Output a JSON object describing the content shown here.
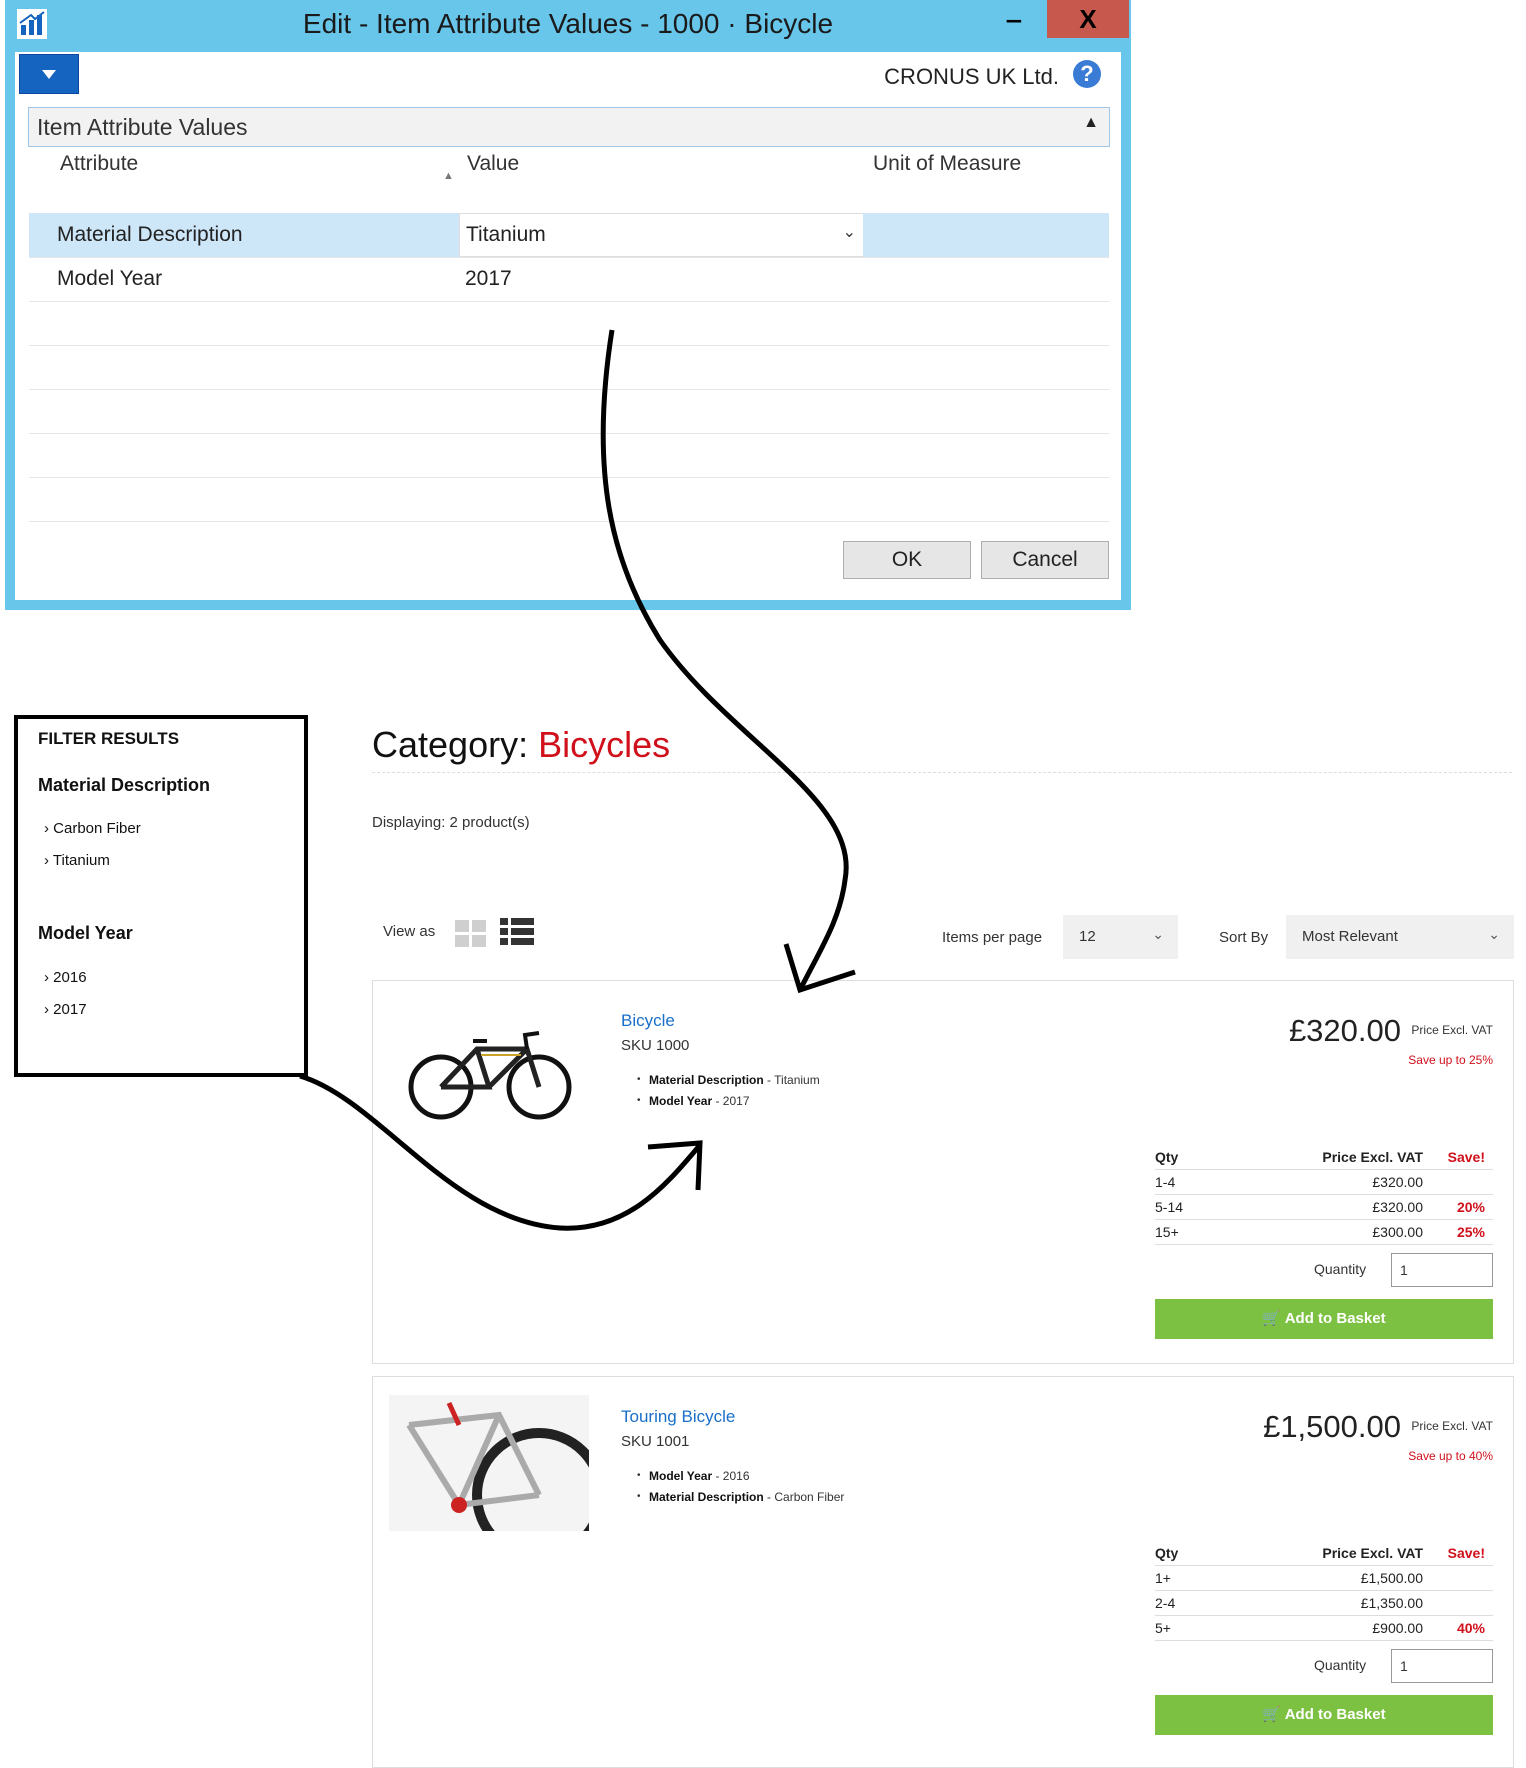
{
  "dialog": {
    "title": "Edit - Item Attribute Values - 1000 · Bicycle",
    "minimize": "‒",
    "maximize": "□",
    "close": "X",
    "company": "CRONUS UK Ltd.",
    "help": "?",
    "section": "Item Attribute Values",
    "columns": {
      "attribute": "Attribute",
      "value": "Value",
      "uom": "Unit of Measure"
    },
    "rows": [
      {
        "attribute": "Material Description",
        "value": "Titanium",
        "uom": ""
      },
      {
        "attribute": "Model Year",
        "value": "2017",
        "uom": ""
      }
    ],
    "ok": "OK",
    "cancel": "Cancel"
  },
  "filter": {
    "heading": "FILTER RESULTS",
    "groups": [
      {
        "name": "Material Description",
        "options": [
          "Carbon Fiber",
          "Titanium"
        ]
      },
      {
        "name": "Model Year",
        "options": [
          "2016",
          "2017"
        ]
      }
    ]
  },
  "shop": {
    "category_label": "Category:",
    "category_name": "Bicycles",
    "displaying": "Displaying: 2 product(s)",
    "view_as": "View as",
    "items_per_page_label": "Items per page",
    "items_per_page": "12",
    "sort_by_label": "Sort By",
    "sort_by": "Most Relevant",
    "products": [
      {
        "name": "Bicycle",
        "sku": "SKU 1000",
        "attributes": [
          {
            "name": "Material Description",
            "value": " - Titanium"
          },
          {
            "name": "Model Year",
            "value": " - 2017"
          }
        ],
        "price": "£320.00",
        "price_note": "Price Excl. VAT",
        "save_up": "Save up to 25%",
        "tier_head": {
          "qty": "Qty",
          "price": "Price Excl. VAT",
          "save": "Save!"
        },
        "tiers": [
          {
            "qty": "1-4",
            "price": "£320.00",
            "save": ""
          },
          {
            "qty": "5-14",
            "price": "£320.00",
            "save": "20%"
          },
          {
            "qty": "15+",
            "price": "£300.00",
            "save": "25%"
          }
        ],
        "quantity_label": "Quantity",
        "quantity": "1",
        "basket": "Add to Basket"
      },
      {
        "name": "Touring Bicycle",
        "sku": "SKU 1001",
        "attributes": [
          {
            "name": "Model Year",
            "value": " - 2016"
          },
          {
            "name": "Material Description",
            "value": " - Carbon Fiber"
          }
        ],
        "price": "£1,500.00",
        "price_note": "Price Excl. VAT",
        "save_up": "Save up to 40%",
        "tier_head": {
          "qty": "Qty",
          "price": "Price Excl. VAT",
          "save": "Save!"
        },
        "tiers": [
          {
            "qty": "1+",
            "price": "£1,500.00",
            "save": ""
          },
          {
            "qty": "2-4",
            "price": "£1,350.00",
            "save": ""
          },
          {
            "qty": "5+",
            "price": "£900.00",
            "save": "40%"
          }
        ],
        "quantity_label": "Quantity",
        "quantity": "1",
        "basket": "Add to Basket"
      }
    ]
  },
  "colors": {
    "accent_red": "#d0101b",
    "link_blue": "#1a6fc9",
    "basket_green": "#7cc142",
    "dialog_frame": "#67c6ea"
  }
}
